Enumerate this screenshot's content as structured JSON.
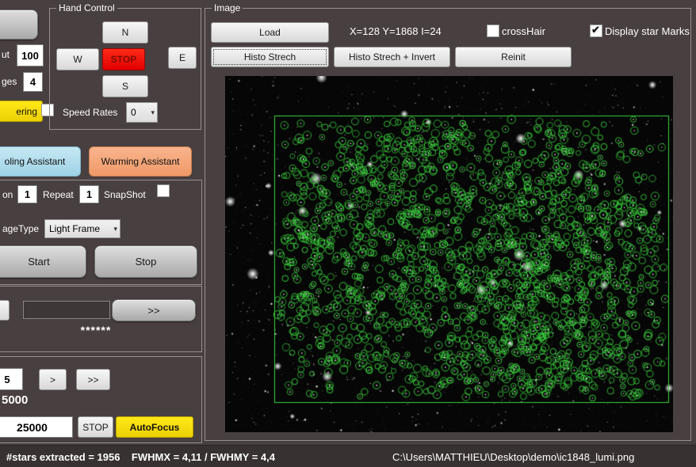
{
  "left_panel": {
    "timeout_label": "ut",
    "timeout_value": "100",
    "frames_label": "ges",
    "frames_value": "4",
    "dithering_label": "ering",
    "dithering_checked": false,
    "cooling_label": "oling Assistant",
    "warming_label": "Warming Assistant",
    "exposure_label": "on",
    "exposure_value": "1",
    "repeat_label": "Repeat",
    "repeat_value": "1",
    "snapshot_label": "SnapShot",
    "snapshot_checked": false,
    "imagetype_label": "ageType",
    "imagetype_value": "Light Frame",
    "start_label": "Start",
    "stop_label": "Stop",
    "send_label": ">>",
    "masked_text": "******",
    "focuser": {
      "position_value": "5",
      "step_label": ">",
      "fast_step_label": ">>",
      "current_position": "5000",
      "target_position": "25000",
      "stop_label": "STOP",
      "autofocus_label": "AutoFocus"
    }
  },
  "hand_control": {
    "title": "Hand Control",
    "north_label": "N",
    "west_label": "W",
    "stop_label": "STOP",
    "east_label": "E",
    "south_label": "S",
    "speed_rates_label": "Speed Rates",
    "speed_value": "0"
  },
  "image_panel": {
    "title": "Image",
    "load_label": "Load",
    "coords_text": "X=128 Y=1868 I=24",
    "crosshair_label": "crossHair",
    "crosshair_checked": false,
    "star_marks_label": "Display star Marks",
    "star_marks_checked": true,
    "histo_label": "Histo Strech",
    "histo_invert_label": "Histo Strech + Invert",
    "reinit_label": "Reinit",
    "mark_color": "#3ad23c"
  },
  "status_bar": {
    "stats_text": "#stars extracted = 1956    FWHMX = 4,11 / FWHMY = 4,4",
    "file_path": "C:\\Users\\MATTHIEU\\Desktop\\demo\\ic1848_lumi.png"
  }
}
